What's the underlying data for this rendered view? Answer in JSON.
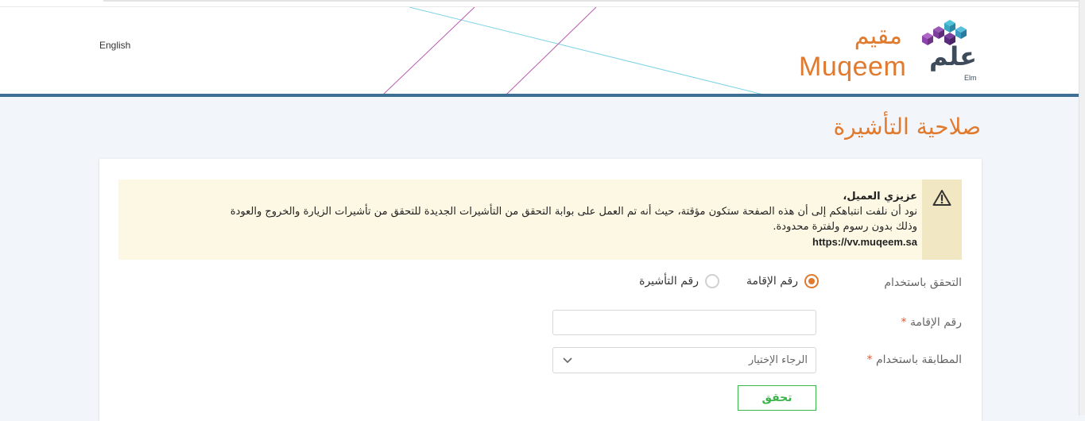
{
  "header": {
    "language_link": "English",
    "brand_ar": "مقيم",
    "brand_en": "Muqeem",
    "partner_ar": "علم",
    "partner_en": "Elm"
  },
  "page": {
    "title": "صلاحية التأشيرة"
  },
  "alert": {
    "title": "عزيزي العميل،",
    "line1": "نود أن نلفت انتباهكم إلى أن هذه الصفحة ستكون مؤقتة، حيث أنه تم العمل على بوابة التحقق من التأشيرات الجديدة للتحقق من تأشيرات الزيارة والخروج والعودة",
    "line2": "وذلك بدون رسوم ولفترة محدودة.",
    "url": "https://vv.muqeem.sa",
    "icon": "warning-icon"
  },
  "form": {
    "verify_by_label": "التحقق باستخدام",
    "options": [
      {
        "label": "رقم الإقامة",
        "selected": true
      },
      {
        "label": "رقم التأشيرة",
        "selected": false
      }
    ],
    "iqama_label": "رقم الإقامة",
    "iqama_value": "",
    "match_label": "المطابقة باستخدام",
    "match_placeholder": "الرجاء الإختيار",
    "required_mark": "*",
    "submit_label": "تحقق"
  },
  "colors": {
    "brand_orange": "#e07a2f",
    "header_border": "#3d6e94",
    "alert_bg": "#fdf8e4",
    "success_green": "#3ab54a"
  }
}
